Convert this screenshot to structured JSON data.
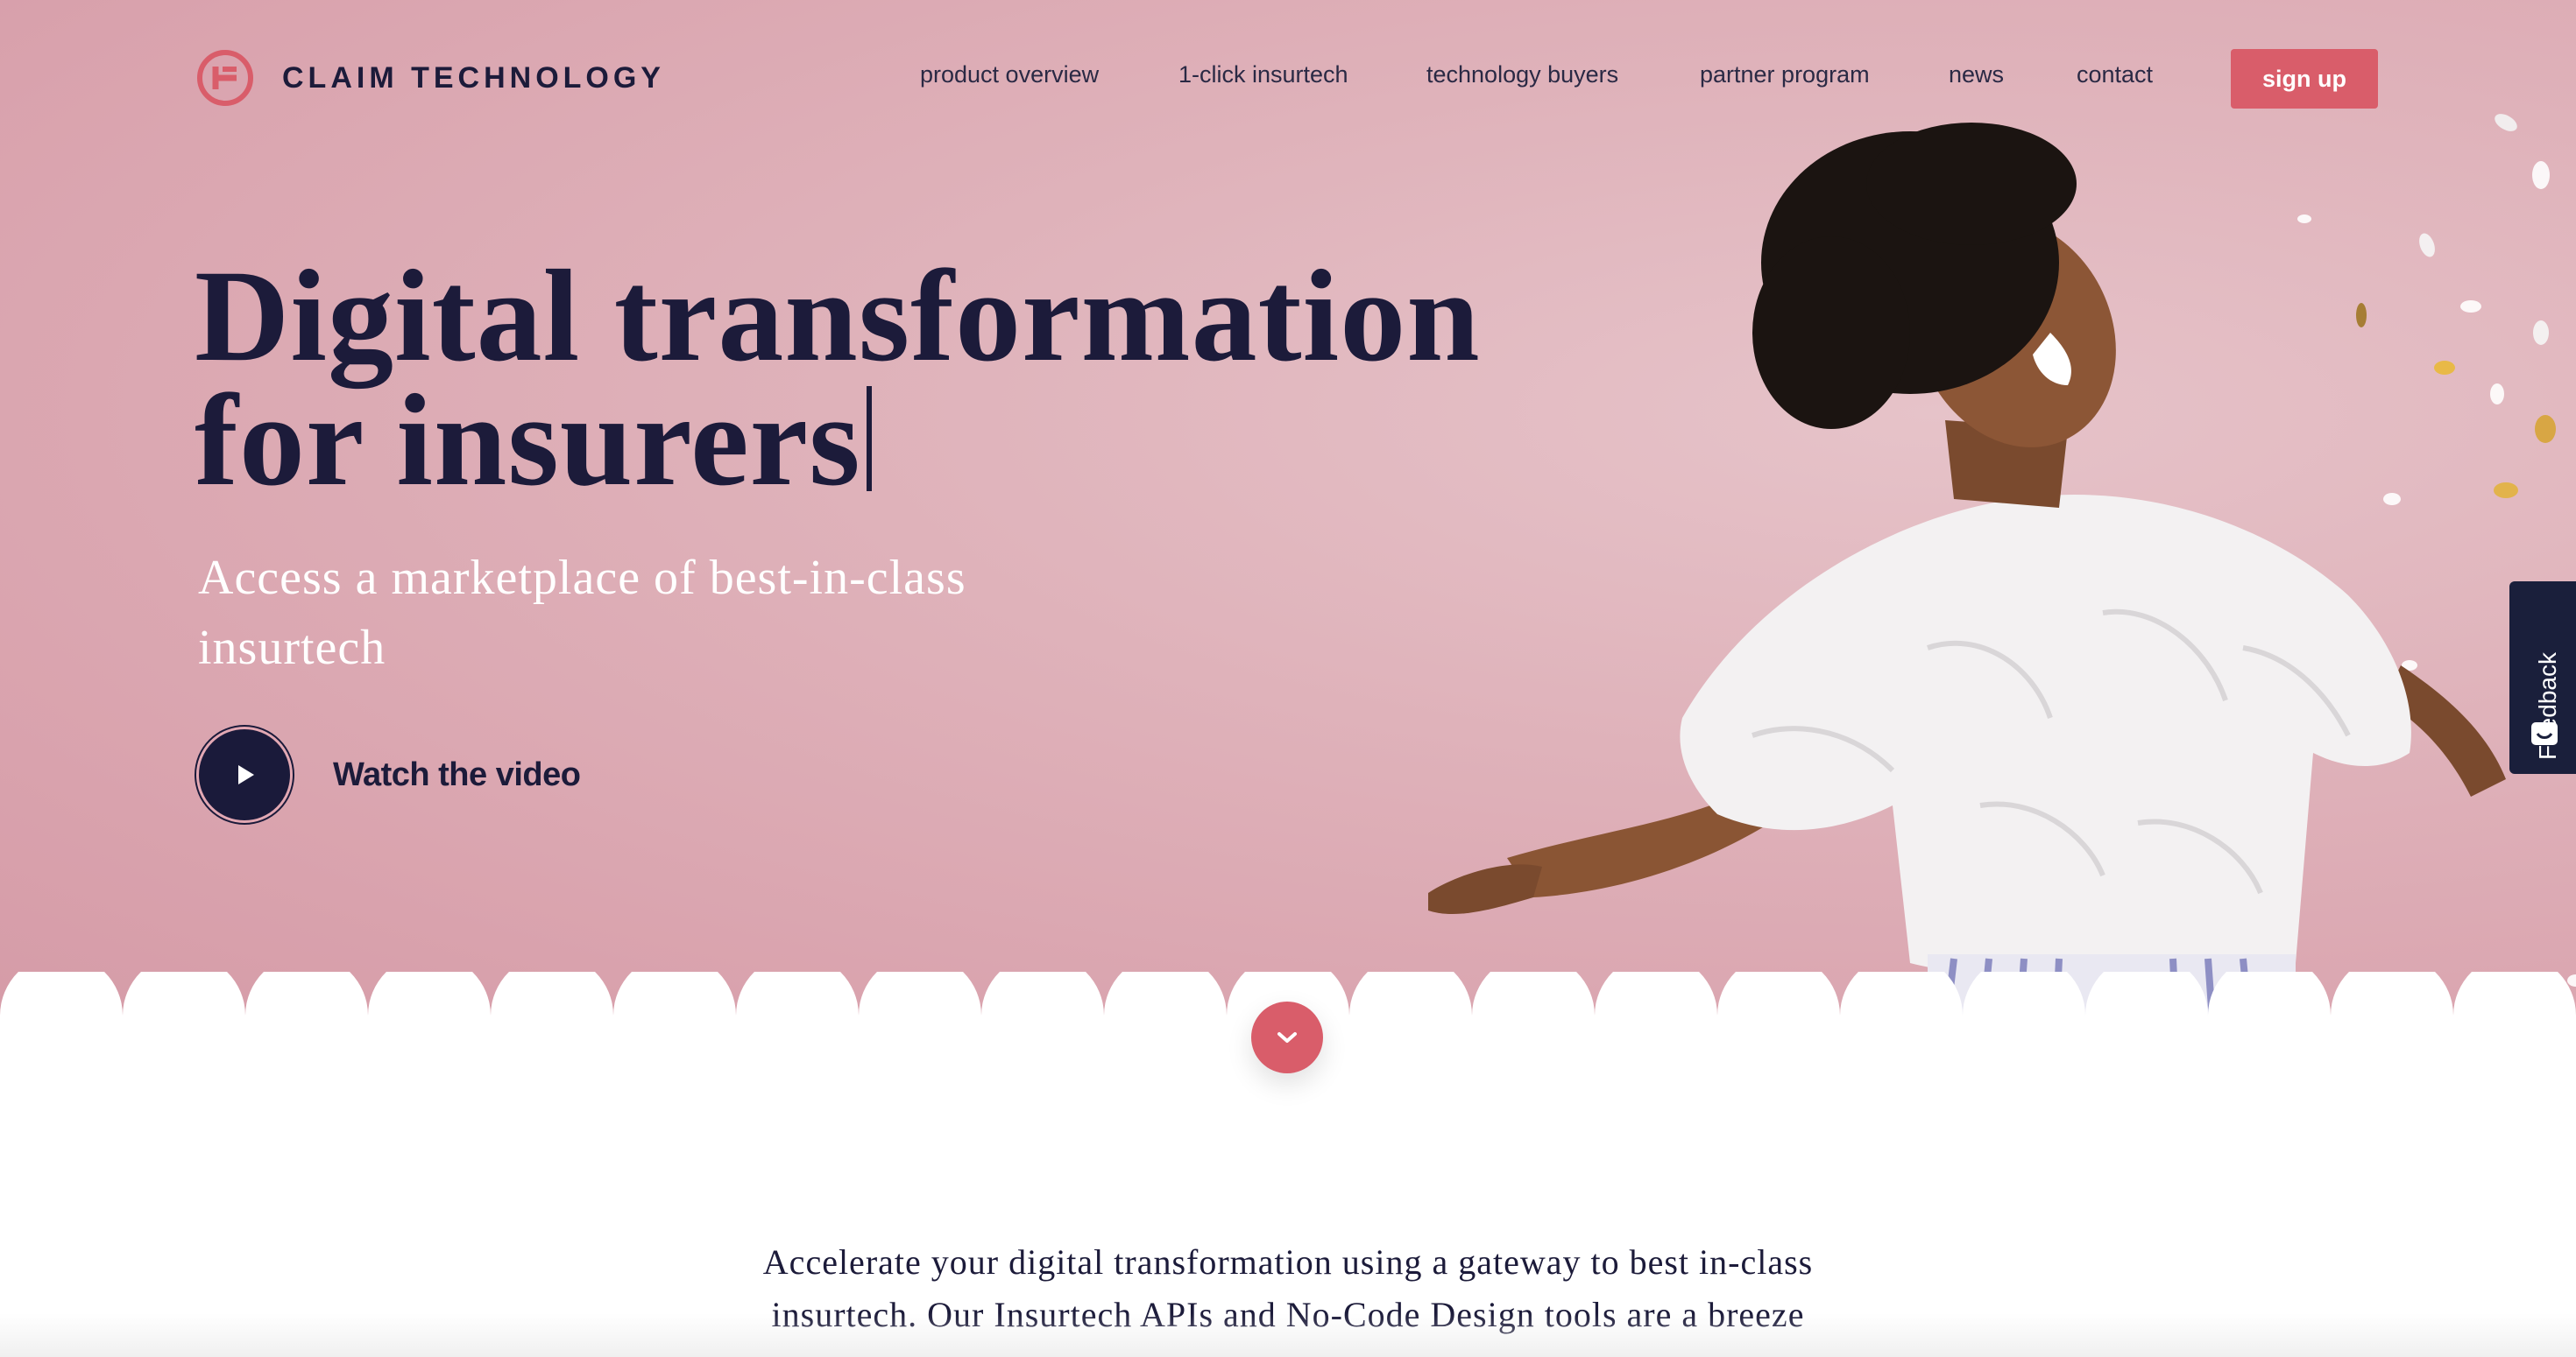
{
  "brand": {
    "name": "CLAIM TECHNOLOGY",
    "accent": "#d95d6a",
    "navy": "#1c1b3a"
  },
  "nav": {
    "items": [
      {
        "label": "product overview"
      },
      {
        "label": "1-click insurtech"
      },
      {
        "label": "technology buyers"
      },
      {
        "label": "partner program"
      },
      {
        "label": "news"
      },
      {
        "label": "contact"
      }
    ],
    "signup_label": "sign up"
  },
  "hero": {
    "headline_line1": "Digital transformation",
    "headline_line2": "for insurers",
    "subheadline": "Access a marketplace of best-in-class insurtech",
    "video_label": "Watch the video"
  },
  "feedback": {
    "label": "Feedback"
  },
  "intro": {
    "line1": "Accelerate your digital transformation using a gateway to best in-class",
    "line2": "insurtech. Our Insurtech APIs and No-Code Design tools are a breeze"
  },
  "icons": {
    "logo": "claim-logo-icon",
    "play": "play-icon",
    "scroll": "chevron-down-icon",
    "feedback": "chat-icon"
  }
}
